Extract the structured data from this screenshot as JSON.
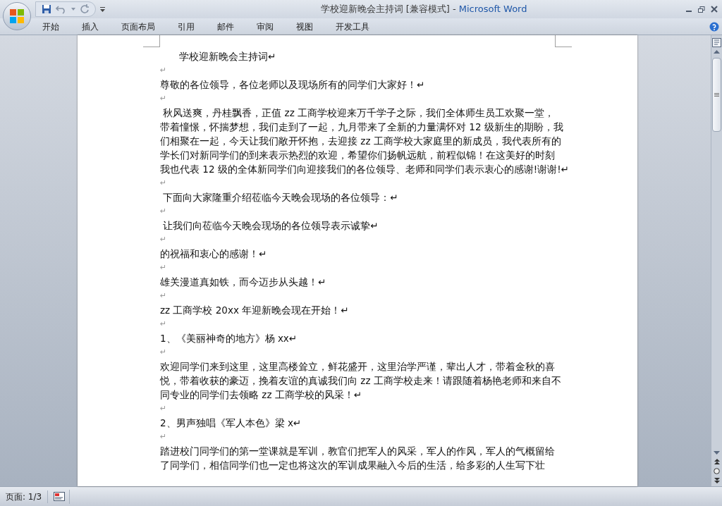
{
  "window": {
    "document": "学校迎新晚会主持词 [兼容模式]",
    "separator": " - ",
    "app": "Microsoft Word"
  },
  "tabs": [
    {
      "label": "开始",
      "selected": false
    },
    {
      "label": "插入",
      "selected": false
    },
    {
      "label": "页面布局",
      "selected": false
    },
    {
      "label": "引用",
      "selected": false
    },
    {
      "label": "邮件",
      "selected": false
    },
    {
      "label": "审阅",
      "selected": false
    },
    {
      "label": "视图",
      "selected": false
    },
    {
      "label": "开发工具",
      "selected": false
    }
  ],
  "document": {
    "paragraphs": [
      {
        "kind": "title",
        "lines": [
          "学校迎新晚会主持词↵"
        ]
      },
      {
        "kind": "empty",
        "lines": [
          "↵"
        ]
      },
      {
        "kind": "body",
        "lines": [
          "尊敬的各位领导，各位老师以及现场所有的同学们大家好！↵"
        ]
      },
      {
        "kind": "empty",
        "lines": [
          "↵"
        ]
      },
      {
        "kind": "body",
        "lines": [
          " 秋风送爽，丹桂飘香，正值 zz 工商学校迎来万千学子之际，我们全体师生员工欢聚一堂，",
          "带着憧憬，怀揣梦想，我们走到了一起，九月带来了全新的力量满怀对 12 级新生的期盼，我",
          "们相聚在一起，今天让我们敞开怀抱，去迎接 zz 工商学校大家庭里的新成员，我代表所有的",
          "学长们对新同学们的到来表示热烈的欢迎，希望你们扬帆远航，前程似锦！在这美好的时刻",
          "我也代表 12 级的全体新同学们向迎接我们的各位领导、老师和同学们表示衷心的感谢!谢谢!↵"
        ]
      },
      {
        "kind": "empty",
        "lines": [
          "↵"
        ]
      },
      {
        "kind": "body",
        "lines": [
          " 下面向大家隆重介绍莅临今天晚会现场的各位领导：↵"
        ]
      },
      {
        "kind": "empty",
        "lines": [
          "↵"
        ]
      },
      {
        "kind": "body",
        "lines": [
          " 让我们向莅临今天晚会现场的各位领导表示诚挚↵"
        ]
      },
      {
        "kind": "empty",
        "lines": [
          "↵"
        ]
      },
      {
        "kind": "body",
        "lines": [
          "的祝福和衷心的感谢！↵"
        ]
      },
      {
        "kind": "empty",
        "lines": [
          "↵"
        ]
      },
      {
        "kind": "body",
        "lines": [
          "雄关漫道真如铁，而今迈步从头越！↵"
        ]
      },
      {
        "kind": "empty",
        "lines": [
          "↵"
        ]
      },
      {
        "kind": "body",
        "lines": [
          "zz 工商学校 20xx 年迎新晚会现在开始！↵"
        ]
      },
      {
        "kind": "empty",
        "lines": [
          "↵"
        ]
      },
      {
        "kind": "body",
        "lines": [
          "1、《美丽神奇的地方》杨 xx↵"
        ]
      },
      {
        "kind": "empty",
        "lines": [
          "↵"
        ]
      },
      {
        "kind": "body",
        "lines": [
          "欢迎同学们来到这里，这里高楼耸立，鲜花盛开，这里治学严谨，辈出人才，带着金秋的喜",
          "悦，带着收获的豪迈，挽着友谊的真诚我们向 zz 工商学校走来！请跟随着杨艳老师和来自不",
          "同专业的同学们去领略 zz 工商学校的风采！↵"
        ]
      },
      {
        "kind": "empty",
        "lines": [
          "↵"
        ]
      },
      {
        "kind": "body",
        "lines": [
          "2、男声独唱《军人本色》梁 x↵"
        ]
      },
      {
        "kind": "empty",
        "lines": [
          "↵"
        ]
      },
      {
        "kind": "body",
        "lines": [
          "踏进校门同学们的第一堂课就是军训，教官们把军人的风采，军人的作风，军人的气概留给",
          "了同学们，相信同学们也一定也将这次的军训成果融入今后的生活，给多彩的人生写下壮"
        ]
      }
    ]
  },
  "status_bar": {
    "page": "页面: 1/3"
  }
}
